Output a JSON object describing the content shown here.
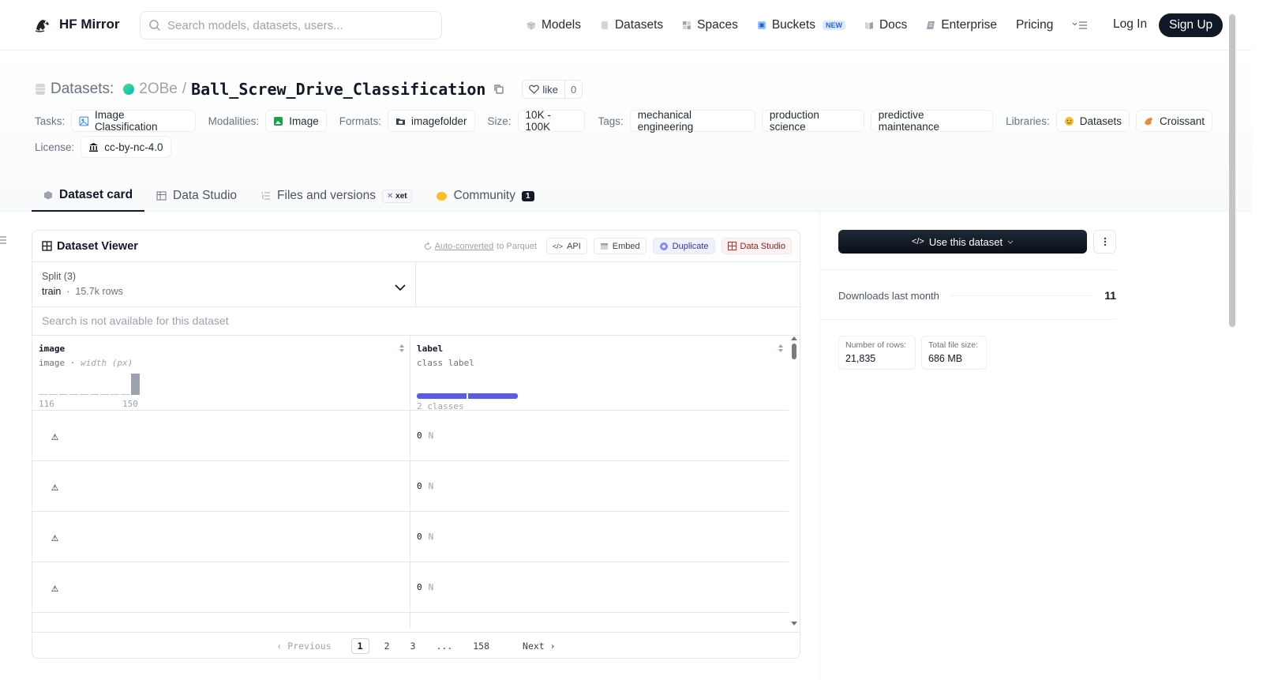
{
  "header": {
    "brand": "HF Mirror",
    "search_placeholder": "Search models, datasets, users...",
    "nav": [
      {
        "label": "Models",
        "icon": "cube-icon"
      },
      {
        "label": "Datasets",
        "icon": "database-icon"
      },
      {
        "label": "Spaces",
        "icon": "grid-icon"
      },
      {
        "label": "Buckets",
        "icon": "bucket-icon",
        "badge": "NEW"
      },
      {
        "label": "Docs",
        "icon": "book-icon"
      },
      {
        "label": "Enterprise",
        "icon": "enterprise-icon"
      },
      {
        "label": "Pricing"
      }
    ],
    "login": "Log In",
    "signup": "Sign Up"
  },
  "dataset": {
    "prefix": "Datasets:",
    "org": "2OBe",
    "separator": "/",
    "name": "Ball_Screw_Drive_Classification",
    "like_label": "like",
    "like_count": "0"
  },
  "tags": {
    "tasks_label": "Tasks:",
    "tasks": [
      "Image Classification"
    ],
    "modalities_label": "Modalities:",
    "modalities": [
      "Image"
    ],
    "formats_label": "Formats:",
    "formats": [
      "imagefolder"
    ],
    "size_label": "Size:",
    "size": "10K - 100K",
    "tags_label": "Tags:",
    "tags": [
      "mechanical engineering",
      "production science",
      "predictive maintenance"
    ],
    "libraries_label": "Libraries:",
    "libraries": [
      "Datasets",
      "Croissant"
    ],
    "license_label": "License:",
    "license": "cc-by-nc-4.0"
  },
  "tabs": [
    {
      "label": "Dataset card",
      "active": true
    },
    {
      "label": "Data Studio"
    },
    {
      "label": "Files and versions",
      "badge": "xet"
    },
    {
      "label": "Community",
      "count": "1"
    }
  ],
  "viewer": {
    "title": "Dataset Viewer",
    "auto_link": "Auto-converted",
    "auto_rest": "to Parquet",
    "api": "API",
    "embed": "Embed",
    "duplicate": "Duplicate",
    "data_studio": "Data Studio",
    "split_label": "Split (3)",
    "split_value": "train",
    "split_rows": "15.7k rows",
    "search_na": "Search is not available for this dataset",
    "columns": [
      {
        "name": "image",
        "type": "image",
        "sub": "width (px)",
        "min": "116",
        "max": "150"
      },
      {
        "name": "label",
        "type": "class label",
        "classes": "2 classes"
      }
    ],
    "histogram": [
      0.04,
      0.0,
      0.04,
      0.0,
      0.0,
      0.0,
      0.0,
      0.04,
      0.04,
      1.0
    ],
    "class_shares": [
      0.5,
      0.5
    ],
    "rows": [
      {
        "label": "0",
        "label_name": "N"
      },
      {
        "label": "0",
        "label_name": "N"
      },
      {
        "label": "0",
        "label_name": "N"
      },
      {
        "label": "0",
        "label_name": "N"
      }
    ],
    "pager": {
      "prev": "Previous",
      "pages": [
        "1",
        "2",
        "3",
        "...",
        "158"
      ],
      "next": "Next"
    }
  },
  "sidebar": {
    "use_button": "Use this dataset",
    "downloads_label": "Downloads last month",
    "downloads": "11",
    "rows_label": "Number of rows:",
    "rows_value": "21,835",
    "size_label": "Total file size:",
    "size_value": "686 MB"
  }
}
